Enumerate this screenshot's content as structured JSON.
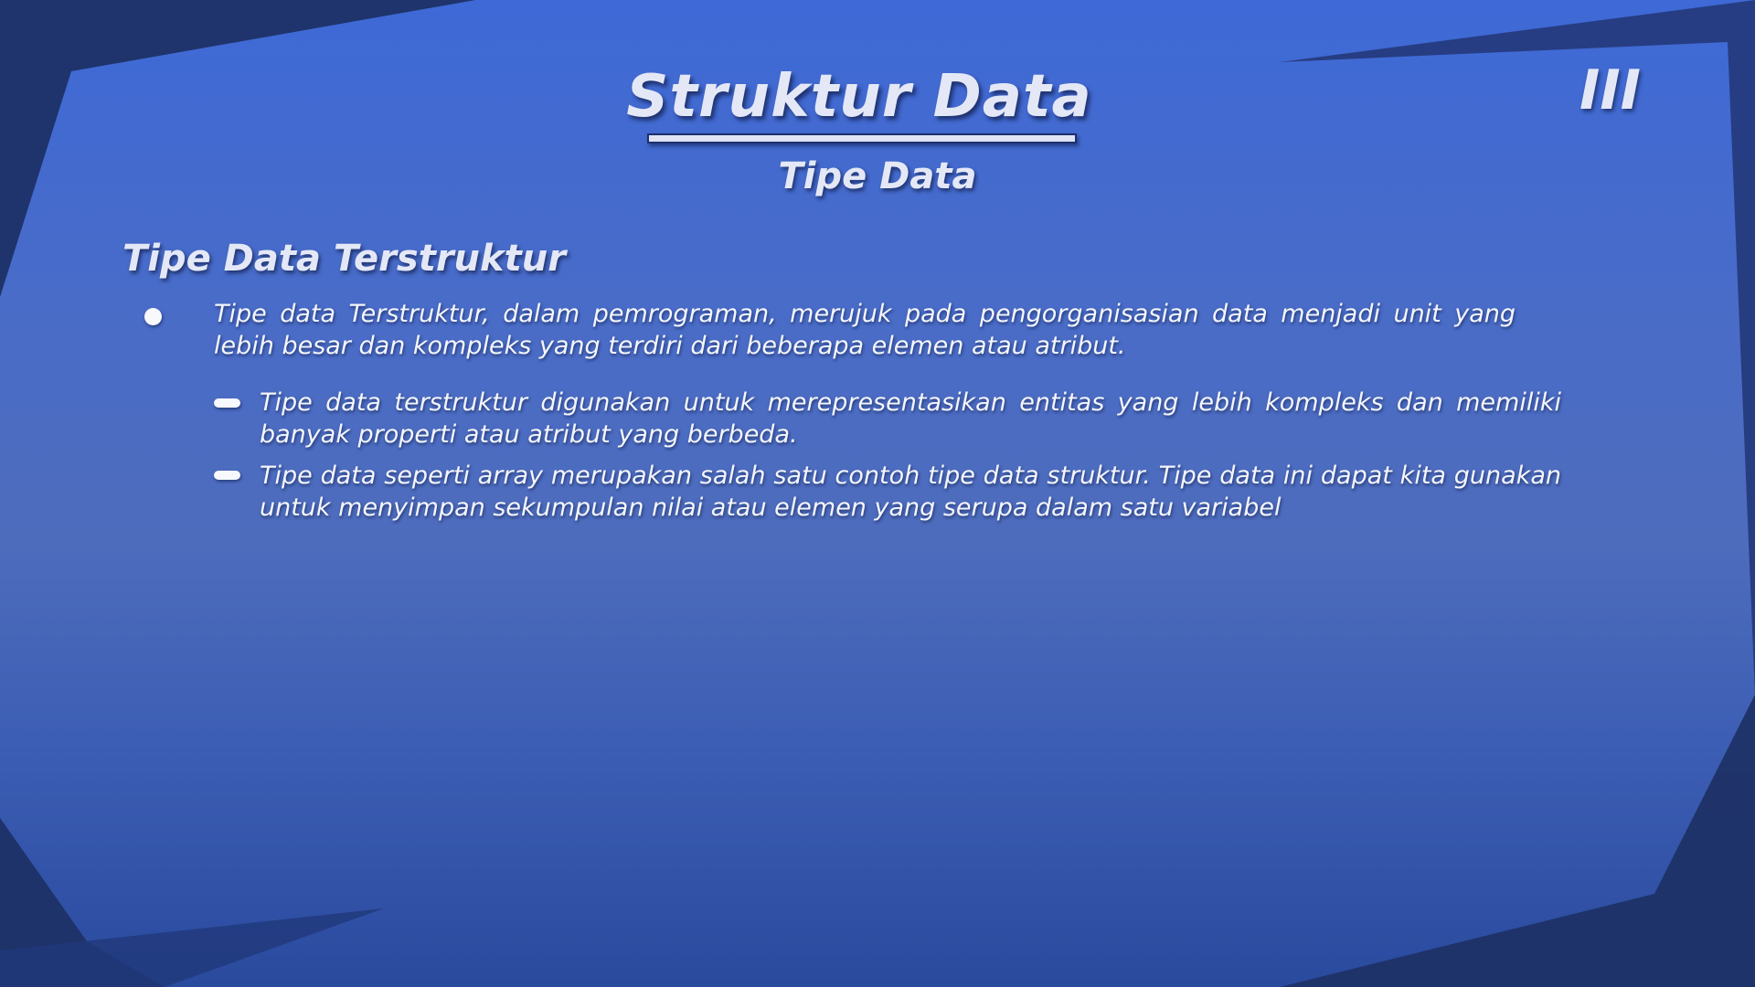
{
  "slide": {
    "title": "Struktur Data",
    "subtitle": "Tipe Data",
    "page_mark": "III",
    "section_heading": "Tipe Data Terstruktur",
    "bullet": {
      "text": "Tipe data Terstruktur, dalam pemrograman, merujuk pada pengorganisasian data menjadi unit yang lebih besar dan kompleks yang terdiri dari beberapa elemen atau atribut."
    },
    "sub_bullets": [
      {
        "text": "Tipe data terstruktur digunakan untuk merepresentasikan entitas yang lebih kompleks dan memiliki banyak properti atau atribut yang berbeda."
      },
      {
        "text": "Tipe data seperti array merupakan salah satu contoh tipe data struktur. Tipe data ini dapat kita gunakan untuk menyimpan sekumpulan nilai atau elemen yang serupa dalam satu variabel"
      }
    ]
  },
  "colors": {
    "background_top": "#3e69d6",
    "background_bottom": "#2a4a9e",
    "corner_shape": "#1e3166",
    "text": "#f4f6fc"
  }
}
